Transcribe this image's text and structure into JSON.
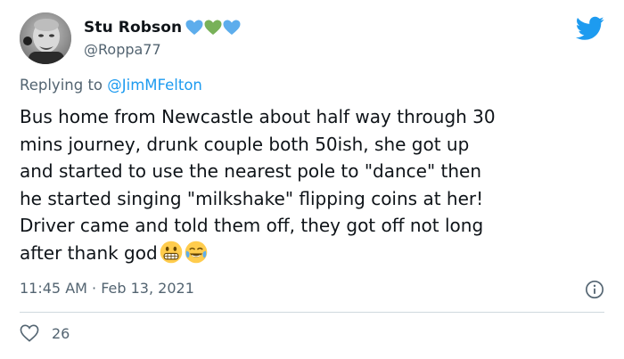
{
  "author": {
    "name": "Stu Robson",
    "handle": "@Roppa77",
    "name_emojis": [
      "blue-heart-icon",
      "green-heart-icon",
      "blue-heart-icon"
    ]
  },
  "reply": {
    "prefix": "Replying to ",
    "mention": "@JimMFelton"
  },
  "tweet": {
    "text": "Bus home from Newcastle about half way through 30\nmins journey, drunk couple both 50ish, she got up\nand started to use the nearest pole to \"dance\" then\nhe started singing \"milkshake\" flipping coins at her!\nDriver came and told them off, they got off not long\nafter thank god",
    "trailing_emojis": [
      "grimacing-face-icon",
      "tears-of-joy-icon"
    ]
  },
  "meta": {
    "timestamp": "11:45 AM · Feb 13, 2021"
  },
  "engagement": {
    "likes": "26"
  },
  "colors": {
    "link": "#1d9bf0",
    "muted": "#536471",
    "twitter_blue": "#1d9bf0",
    "heart_blue": "#5dadec",
    "heart_green": "#78b159"
  }
}
